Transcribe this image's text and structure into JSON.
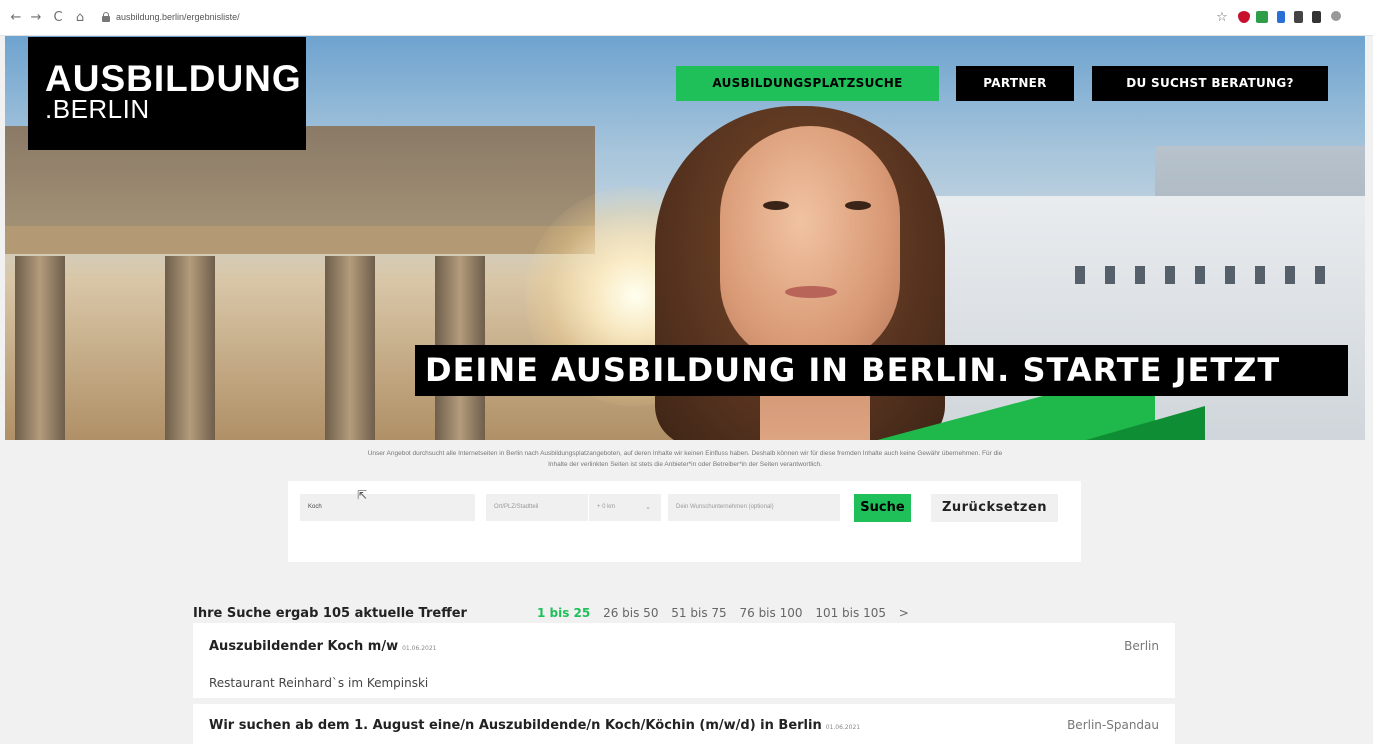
{
  "browser": {
    "url": "ausbildung.berlin/ergebnisliste/",
    "back_icon": "←",
    "forward_icon": "→",
    "reload_icon": "C",
    "home_icon": "⌂",
    "star_icon": "☆"
  },
  "logo": {
    "line1": "AUSBILDUNG",
    "line2": ".BERLIN"
  },
  "nav": {
    "items": [
      {
        "label": "AUSBILDUNGSPLATZSUCHE",
        "active": true
      },
      {
        "label": "PARTNER",
        "active": false
      },
      {
        "label": "DU SUCHST BERATUNG?",
        "active": false
      }
    ]
  },
  "hero": {
    "tagline": "DEINE AUSBILDUNG IN BERLIN. STARTE JETZT"
  },
  "disclaimer": {
    "line1": "Unser Angebot durchsucht alle Internetseiten in Berlin nach Ausbildungsplatzangeboten, auf deren Inhalte wir keinen Einfluss haben. Deshalb können wir für diese fremden Inhalte auch keine Gewähr übernehmen. Für die",
    "line2": "Inhalte der verlinkten Seiten ist stets die Anbieter*in oder Betreiber*in der Seiten verantwortlich."
  },
  "search": {
    "keyword_value": "Koch",
    "location_placeholder": "Ort/PLZ/Stadtteil",
    "radius_value": "+ 0 km",
    "wish_placeholder": "Dein Wunschunternehmen (optional)",
    "search_label": "Suche",
    "reset_label": "Zurücksetzen"
  },
  "results": {
    "count_text": "Ihre Suche ergab 105 aktuelle Treffer",
    "pages": [
      "1 bis 25",
      "26 bis 50",
      "51 bis 75",
      "76 bis 100",
      "101 bis 105",
      ">"
    ],
    "current_page": "1 bis 25",
    "items": [
      {
        "title": "Auszubildender Koch m/w",
        "date": "01.06.2021",
        "location": "Berlin",
        "company": "Restaurant Reinhard`s im Kempinski"
      },
      {
        "title": "Wir suchen ab dem 1. August eine/n Auszubildende/n Koch/Köchin (m/w/d) in Berlin",
        "date": "01.06.2021",
        "location": "Berlin-Spandau",
        "company": ""
      }
    ]
  },
  "colors": {
    "accent": "#1fc05a",
    "black": "#000000",
    "page_bg": "#f1f1f1"
  }
}
